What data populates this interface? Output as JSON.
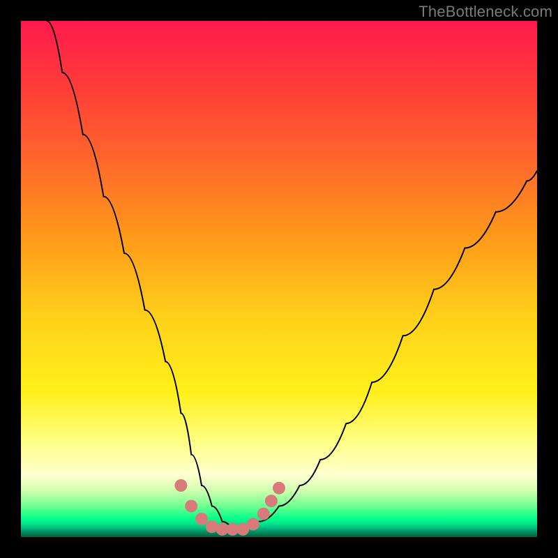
{
  "watermark": "TheBottleneck.com",
  "chart_data": {
    "type": "line",
    "title": "",
    "xlabel": "",
    "ylabel": "",
    "xlim": [
      0,
      100
    ],
    "ylim": [
      0,
      100
    ],
    "grid": false,
    "legend": false,
    "series": [
      {
        "name": "bottleneck-curve",
        "x": [
          5,
          8,
          12,
          16,
          20,
          24,
          28,
          31,
          33,
          35,
          37,
          39,
          41,
          43,
          46,
          50,
          54,
          58,
          63,
          68,
          74,
          80,
          86,
          92,
          98,
          100
        ],
        "y": [
          100,
          90,
          78,
          66,
          55,
          44,
          34,
          24,
          16,
          10,
          6,
          3,
          1.5,
          1.5,
          3,
          6,
          10,
          15,
          22,
          30,
          39,
          48,
          56,
          63,
          69,
          71
        ],
        "color": "#000000"
      },
      {
        "name": "optimal-markers",
        "x": [
          31,
          33,
          35,
          37,
          39,
          41,
          43,
          45,
          47,
          48.5,
          50
        ],
        "y": [
          10,
          6,
          3.5,
          2,
          1.5,
          1.5,
          1.5,
          2.5,
          4.5,
          7,
          9.5
        ],
        "color": "#d97a7a",
        "type": "scatter"
      }
    ]
  }
}
